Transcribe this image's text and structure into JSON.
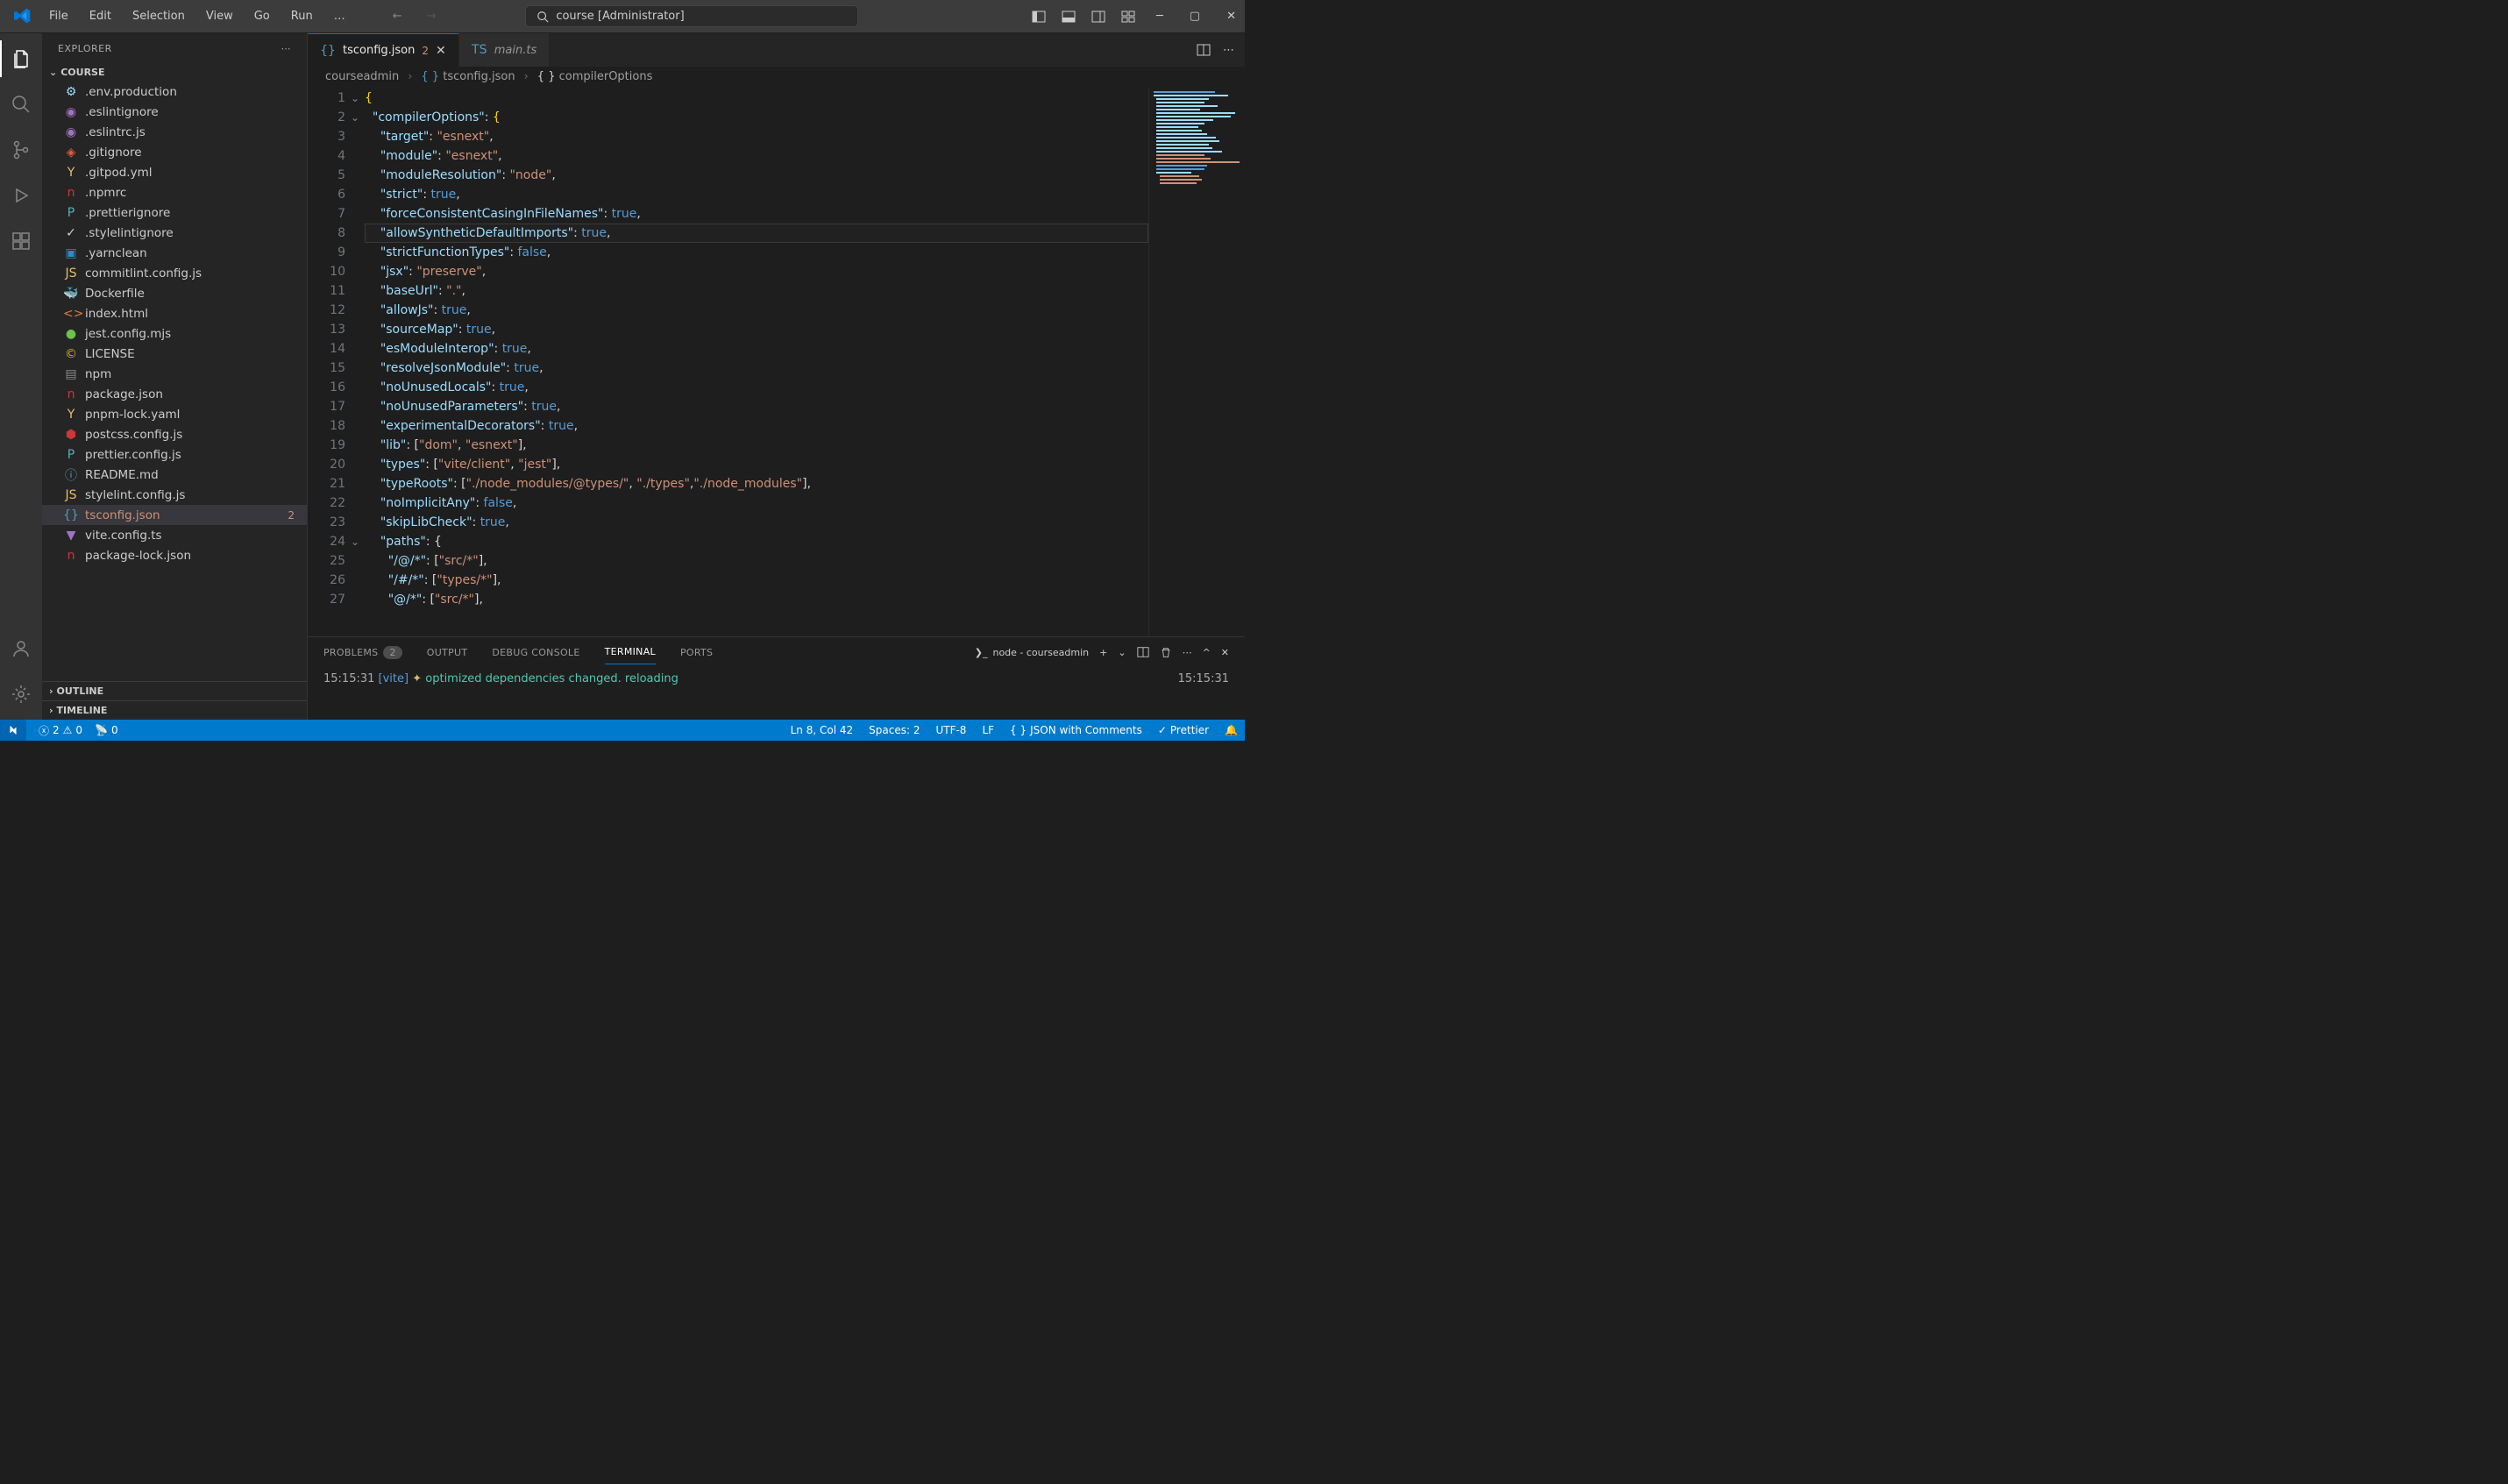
{
  "title": {
    "search": "course [Administrator]"
  },
  "menu": [
    "File",
    "Edit",
    "Selection",
    "View",
    "Go",
    "Run",
    "…"
  ],
  "activity": [
    "explorer",
    "search",
    "scm",
    "debug",
    "extensions"
  ],
  "sidebar": {
    "header": "EXPLORER",
    "project": "COURSE",
    "files": [
      {
        "name": ".env.production",
        "icon": "⚙",
        "color": "#9cdcfe"
      },
      {
        "name": ".eslintignore",
        "icon": "◉",
        "color": "#a074c4"
      },
      {
        "name": ".eslintrc.js",
        "icon": "◉",
        "color": "#a074c4"
      },
      {
        "name": ".gitignore",
        "icon": "◈",
        "color": "#e05b3f"
      },
      {
        "name": ".gitpod.yml",
        "icon": "Y",
        "color": "#e8bf6a"
      },
      {
        "name": ".npmrc",
        "icon": "n",
        "color": "#cb3837"
      },
      {
        "name": ".prettierignore",
        "icon": "P",
        "color": "#56b3b4"
      },
      {
        "name": ".stylelintignore",
        "icon": "✓",
        "color": "#d0d0d0"
      },
      {
        "name": ".yarnclean",
        "icon": "▣",
        "color": "#2c8ebb"
      },
      {
        "name": "commitlint.config.js",
        "icon": "JS",
        "color": "#e8bf6a"
      },
      {
        "name": "Dockerfile",
        "icon": "🐳",
        "color": "#0db7ed"
      },
      {
        "name": "index.html",
        "icon": "<>",
        "color": "#e37933"
      },
      {
        "name": "jest.config.mjs",
        "icon": "●",
        "color": "#6cc24a"
      },
      {
        "name": "LICENSE",
        "icon": "©",
        "color": "#d4b32e"
      },
      {
        "name": "npm",
        "icon": "▤",
        "color": "#8b8b8b"
      },
      {
        "name": "package.json",
        "icon": "n",
        "color": "#cb3837"
      },
      {
        "name": "pnpm-lock.yaml",
        "icon": "Y",
        "color": "#e8bf6a"
      },
      {
        "name": "postcss.config.js",
        "icon": "⬢",
        "color": "#cb3837"
      },
      {
        "name": "prettier.config.js",
        "icon": "P",
        "color": "#56b3b4"
      },
      {
        "name": "README.md",
        "icon": "ⓘ",
        "color": "#519aba"
      },
      {
        "name": "stylelint.config.js",
        "icon": "JS",
        "color": "#e8bf6a"
      },
      {
        "name": "tsconfig.json",
        "icon": "{}",
        "color": "#519aba",
        "selected": true,
        "problems": "2"
      },
      {
        "name": "vite.config.ts",
        "icon": "▼",
        "color": "#a074c4"
      },
      {
        "name": "package-lock.json",
        "icon": "n",
        "color": "#cb3837",
        "locked": true
      }
    ],
    "outline": "OUTLINE",
    "timeline": "TIMELINE"
  },
  "tabs": [
    {
      "name": "tsconfig.json",
      "icon": "{}",
      "problems": "2",
      "active": true
    },
    {
      "name": "main.ts",
      "icon": "TS",
      "italic": true
    }
  ],
  "breadcrumbs": [
    "courseadmin",
    "tsconfig.json",
    "compilerOptions"
  ],
  "code_lines": [
    {
      "n": 1,
      "fold": true,
      "indent": 0,
      "tokens": [
        [
          "{",
          "brace"
        ]
      ]
    },
    {
      "n": 2,
      "fold": true,
      "indent": 1,
      "tokens": [
        [
          "\"compilerOptions\"",
          "key"
        ],
        [
          ":",
          "punct"
        ],
        [
          " ",
          ""
        ],
        [
          "{",
          "brace"
        ]
      ]
    },
    {
      "n": 3,
      "indent": 2,
      "tokens": [
        [
          "\"target\"",
          "key"
        ],
        [
          ":",
          "punct"
        ],
        [
          " ",
          ""
        ],
        [
          "\"esnext\"",
          "str"
        ],
        [
          ",",
          "punct"
        ]
      ]
    },
    {
      "n": 4,
      "indent": 2,
      "tokens": [
        [
          "\"module\"",
          "key"
        ],
        [
          ":",
          "punct"
        ],
        [
          " ",
          ""
        ],
        [
          "\"esnext\"",
          "str"
        ],
        [
          ",",
          "punct"
        ]
      ]
    },
    {
      "n": 5,
      "indent": 2,
      "tokens": [
        [
          "\"moduleResolution\"",
          "key"
        ],
        [
          ":",
          "punct"
        ],
        [
          " ",
          ""
        ],
        [
          "\"node\"",
          "str"
        ],
        [
          ",",
          "punct"
        ]
      ]
    },
    {
      "n": 6,
      "indent": 2,
      "tokens": [
        [
          "\"strict\"",
          "key"
        ],
        [
          ":",
          "punct"
        ],
        [
          " ",
          ""
        ],
        [
          "true",
          "bool"
        ],
        [
          ",",
          "punct"
        ]
      ]
    },
    {
      "n": 7,
      "indent": 2,
      "tokens": [
        [
          "\"forceConsistentCasingInFileNames\"",
          "key"
        ],
        [
          ":",
          "punct"
        ],
        [
          " ",
          ""
        ],
        [
          "true",
          "bool"
        ],
        [
          ",",
          "punct"
        ]
      ]
    },
    {
      "n": 8,
      "cur": true,
      "indent": 2,
      "tokens": [
        [
          "\"allowSyntheticDefaultImports\"",
          "key"
        ],
        [
          ":",
          "punct"
        ],
        [
          " ",
          ""
        ],
        [
          "true",
          "bool"
        ],
        [
          ",",
          "punct"
        ]
      ]
    },
    {
      "n": 9,
      "indent": 2,
      "tokens": [
        [
          "\"strictFunctionTypes\"",
          "key"
        ],
        [
          ":",
          "punct"
        ],
        [
          " ",
          ""
        ],
        [
          "false",
          "bool"
        ],
        [
          ",",
          "punct"
        ]
      ]
    },
    {
      "n": 10,
      "indent": 2,
      "tokens": [
        [
          "\"jsx\"",
          "key"
        ],
        [
          ":",
          "punct"
        ],
        [
          " ",
          ""
        ],
        [
          "\"preserve\"",
          "str"
        ],
        [
          ",",
          "punct"
        ]
      ]
    },
    {
      "n": 11,
      "indent": 2,
      "tokens": [
        [
          "\"baseUrl\"",
          "key"
        ],
        [
          ":",
          "punct"
        ],
        [
          " ",
          ""
        ],
        [
          "\".\"",
          "str"
        ],
        [
          ",",
          "punct"
        ]
      ]
    },
    {
      "n": 12,
      "indent": 2,
      "tokens": [
        [
          "\"allowJs\"",
          "key"
        ],
        [
          ":",
          "punct"
        ],
        [
          " ",
          ""
        ],
        [
          "true",
          "bool"
        ],
        [
          ",",
          "punct"
        ]
      ]
    },
    {
      "n": 13,
      "indent": 2,
      "tokens": [
        [
          "\"sourceMap\"",
          "key"
        ],
        [
          ":",
          "punct"
        ],
        [
          " ",
          ""
        ],
        [
          "true",
          "bool"
        ],
        [
          ",",
          "punct"
        ]
      ]
    },
    {
      "n": 14,
      "indent": 2,
      "tokens": [
        [
          "\"esModuleInterop\"",
          "key"
        ],
        [
          ":",
          "punct"
        ],
        [
          " ",
          ""
        ],
        [
          "true",
          "bool"
        ],
        [
          ",",
          "punct"
        ]
      ]
    },
    {
      "n": 15,
      "indent": 2,
      "tokens": [
        [
          "\"resolveJsonModule\"",
          "key"
        ],
        [
          ":",
          "punct"
        ],
        [
          " ",
          ""
        ],
        [
          "true",
          "bool"
        ],
        [
          ",",
          "punct"
        ]
      ]
    },
    {
      "n": 16,
      "indent": 2,
      "tokens": [
        [
          "\"noUnusedLocals\"",
          "key"
        ],
        [
          ":",
          "punct"
        ],
        [
          " ",
          ""
        ],
        [
          "true",
          "bool"
        ],
        [
          ",",
          "punct"
        ]
      ]
    },
    {
      "n": 17,
      "indent": 2,
      "tokens": [
        [
          "\"noUnusedParameters\"",
          "key"
        ],
        [
          ":",
          "punct"
        ],
        [
          " ",
          ""
        ],
        [
          "true",
          "bool"
        ],
        [
          ",",
          "punct"
        ]
      ]
    },
    {
      "n": 18,
      "indent": 2,
      "tokens": [
        [
          "\"experimentalDecorators\"",
          "key"
        ],
        [
          ":",
          "punct"
        ],
        [
          " ",
          ""
        ],
        [
          "true",
          "bool"
        ],
        [
          ",",
          "punct"
        ]
      ]
    },
    {
      "n": 19,
      "indent": 2,
      "tokens": [
        [
          "\"lib\"",
          "key"
        ],
        [
          ":",
          "punct"
        ],
        [
          " ",
          ""
        ],
        [
          "[",
          "punct"
        ],
        [
          "\"dom\"",
          "str"
        ],
        [
          ", ",
          "punct"
        ],
        [
          "\"esnext\"",
          "str"
        ],
        [
          "]",
          "punct"
        ],
        [
          ",",
          "punct"
        ]
      ]
    },
    {
      "n": 20,
      "indent": 2,
      "tokens": [
        [
          "\"types\"",
          "key"
        ],
        [
          ":",
          "punct"
        ],
        [
          " ",
          ""
        ],
        [
          "[",
          "punct"
        ],
        [
          "\"vite/client\"",
          "str"
        ],
        [
          ", ",
          "punct"
        ],
        [
          "\"jest\"",
          "str"
        ],
        [
          "]",
          "punct"
        ],
        [
          ",",
          "punct"
        ]
      ]
    },
    {
      "n": 21,
      "indent": 2,
      "tokens": [
        [
          "\"typeRoots\"",
          "key"
        ],
        [
          ":",
          "punct"
        ],
        [
          " ",
          ""
        ],
        [
          "[",
          "punct"
        ],
        [
          "\"./node_modules/@types/\"",
          "str"
        ],
        [
          ", ",
          "punct"
        ],
        [
          "\"./types\"",
          "str"
        ],
        [
          ",",
          "punct"
        ],
        [
          "\"./node_modules\"",
          "str"
        ],
        [
          "]",
          "punct"
        ],
        [
          ",",
          "punct"
        ]
      ]
    },
    {
      "n": 22,
      "indent": 2,
      "tokens": [
        [
          "\"noImplicitAny\"",
          "key"
        ],
        [
          ":",
          "punct"
        ],
        [
          " ",
          ""
        ],
        [
          "false",
          "bool"
        ],
        [
          ",",
          "punct"
        ]
      ]
    },
    {
      "n": 23,
      "indent": 2,
      "tokens": [
        [
          "\"skipLibCheck\"",
          "key"
        ],
        [
          ":",
          "punct"
        ],
        [
          " ",
          ""
        ],
        [
          "true",
          "bool"
        ],
        [
          ",",
          "punct"
        ]
      ]
    },
    {
      "n": 24,
      "fold": true,
      "indent": 2,
      "tokens": [
        [
          "\"paths\"",
          "key"
        ],
        [
          ":",
          "punct"
        ],
        [
          " ",
          ""
        ],
        [
          "{",
          "punct"
        ]
      ]
    },
    {
      "n": 25,
      "indent": 3,
      "tokens": [
        [
          "\"/@/*\"",
          "key"
        ],
        [
          ":",
          "punct"
        ],
        [
          " ",
          ""
        ],
        [
          "[",
          "punct"
        ],
        [
          "\"src/*\"",
          "str"
        ],
        [
          "]",
          "punct"
        ],
        [
          ",",
          "punct"
        ]
      ]
    },
    {
      "n": 26,
      "indent": 3,
      "tokens": [
        [
          "\"/#/*\"",
          "key"
        ],
        [
          ":",
          "punct"
        ],
        [
          " ",
          ""
        ],
        [
          "[",
          "punct"
        ],
        [
          "\"types/*\"",
          "str"
        ],
        [
          "]",
          "punct"
        ],
        [
          ",",
          "punct"
        ]
      ]
    },
    {
      "n": 27,
      "indent": 3,
      "tokens": [
        [
          "\"@/*\"",
          "key"
        ],
        [
          ":",
          "punct"
        ],
        [
          " ",
          ""
        ],
        [
          "[",
          "punct"
        ],
        [
          "\"src/*\"",
          "str"
        ],
        [
          "]",
          "punct"
        ],
        [
          ",",
          "punct"
        ]
      ]
    }
  ],
  "panel": {
    "tabs": [
      {
        "label": "PROBLEMS",
        "badge": "2"
      },
      {
        "label": "OUTPUT"
      },
      {
        "label": "DEBUG CONSOLE"
      },
      {
        "label": "TERMINAL",
        "active": true
      },
      {
        "label": "PORTS"
      }
    ],
    "term_label": "node - courseadmin",
    "time": "15:15:31",
    "vite": "[vite]",
    "sparkle": "✦",
    "msg": "optimized dependencies changed. reloading",
    "right_time": "15:15:31"
  },
  "status": {
    "errors": "2",
    "warnings": "0",
    "port": "0",
    "pos": "Ln 8, Col 42",
    "spaces": "Spaces: 2",
    "encoding": "UTF-8",
    "eol": "LF",
    "lang": "JSON with Comments",
    "prettier": "Prettier"
  }
}
